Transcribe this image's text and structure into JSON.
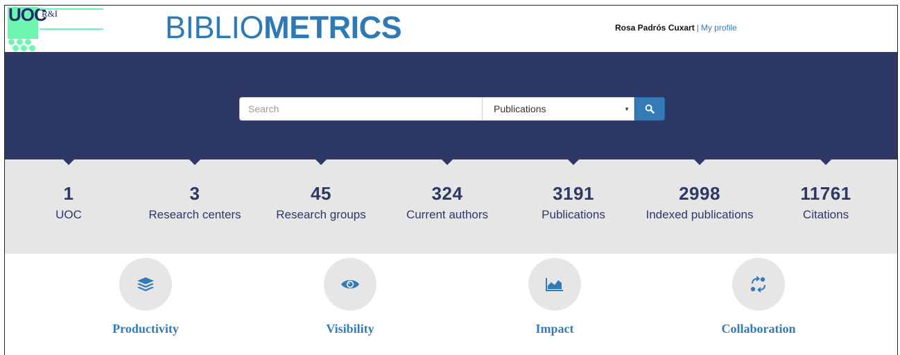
{
  "header": {
    "logo_text": "UOC",
    "logo_sub": "R&I",
    "brand_light": "BIBLIO",
    "brand_bold": "METRICS",
    "user_name": "Rosa Padrós Cuxart",
    "separator": "|",
    "profile_link": "My profile"
  },
  "search": {
    "placeholder": "Search",
    "value": "",
    "selected_option": "Publications",
    "button_icon": "search-icon"
  },
  "stats": [
    {
      "value": "1",
      "label": "UOC"
    },
    {
      "value": "3",
      "label": "Research centers"
    },
    {
      "value": "45",
      "label": "Research groups"
    },
    {
      "value": "324",
      "label": "Current authors"
    },
    {
      "value": "3191",
      "label": "Publications"
    },
    {
      "value": "2998",
      "label": "Indexed publications"
    },
    {
      "value": "11761",
      "label": "Citations"
    }
  ],
  "categories": [
    {
      "label": "Productivity",
      "icon": "layers-icon"
    },
    {
      "label": "Visibility",
      "icon": "eye-icon"
    },
    {
      "label": "Impact",
      "icon": "area-chart-icon"
    },
    {
      "label": "Collaboration",
      "icon": "share-cycle-icon"
    }
  ],
  "colors": {
    "navy": "#2d3867",
    "brand_blue": "#2e7ab6",
    "link_blue": "#337ab7",
    "logo_green": "#6ef5b0",
    "stats_bg": "#e6e6e6"
  }
}
